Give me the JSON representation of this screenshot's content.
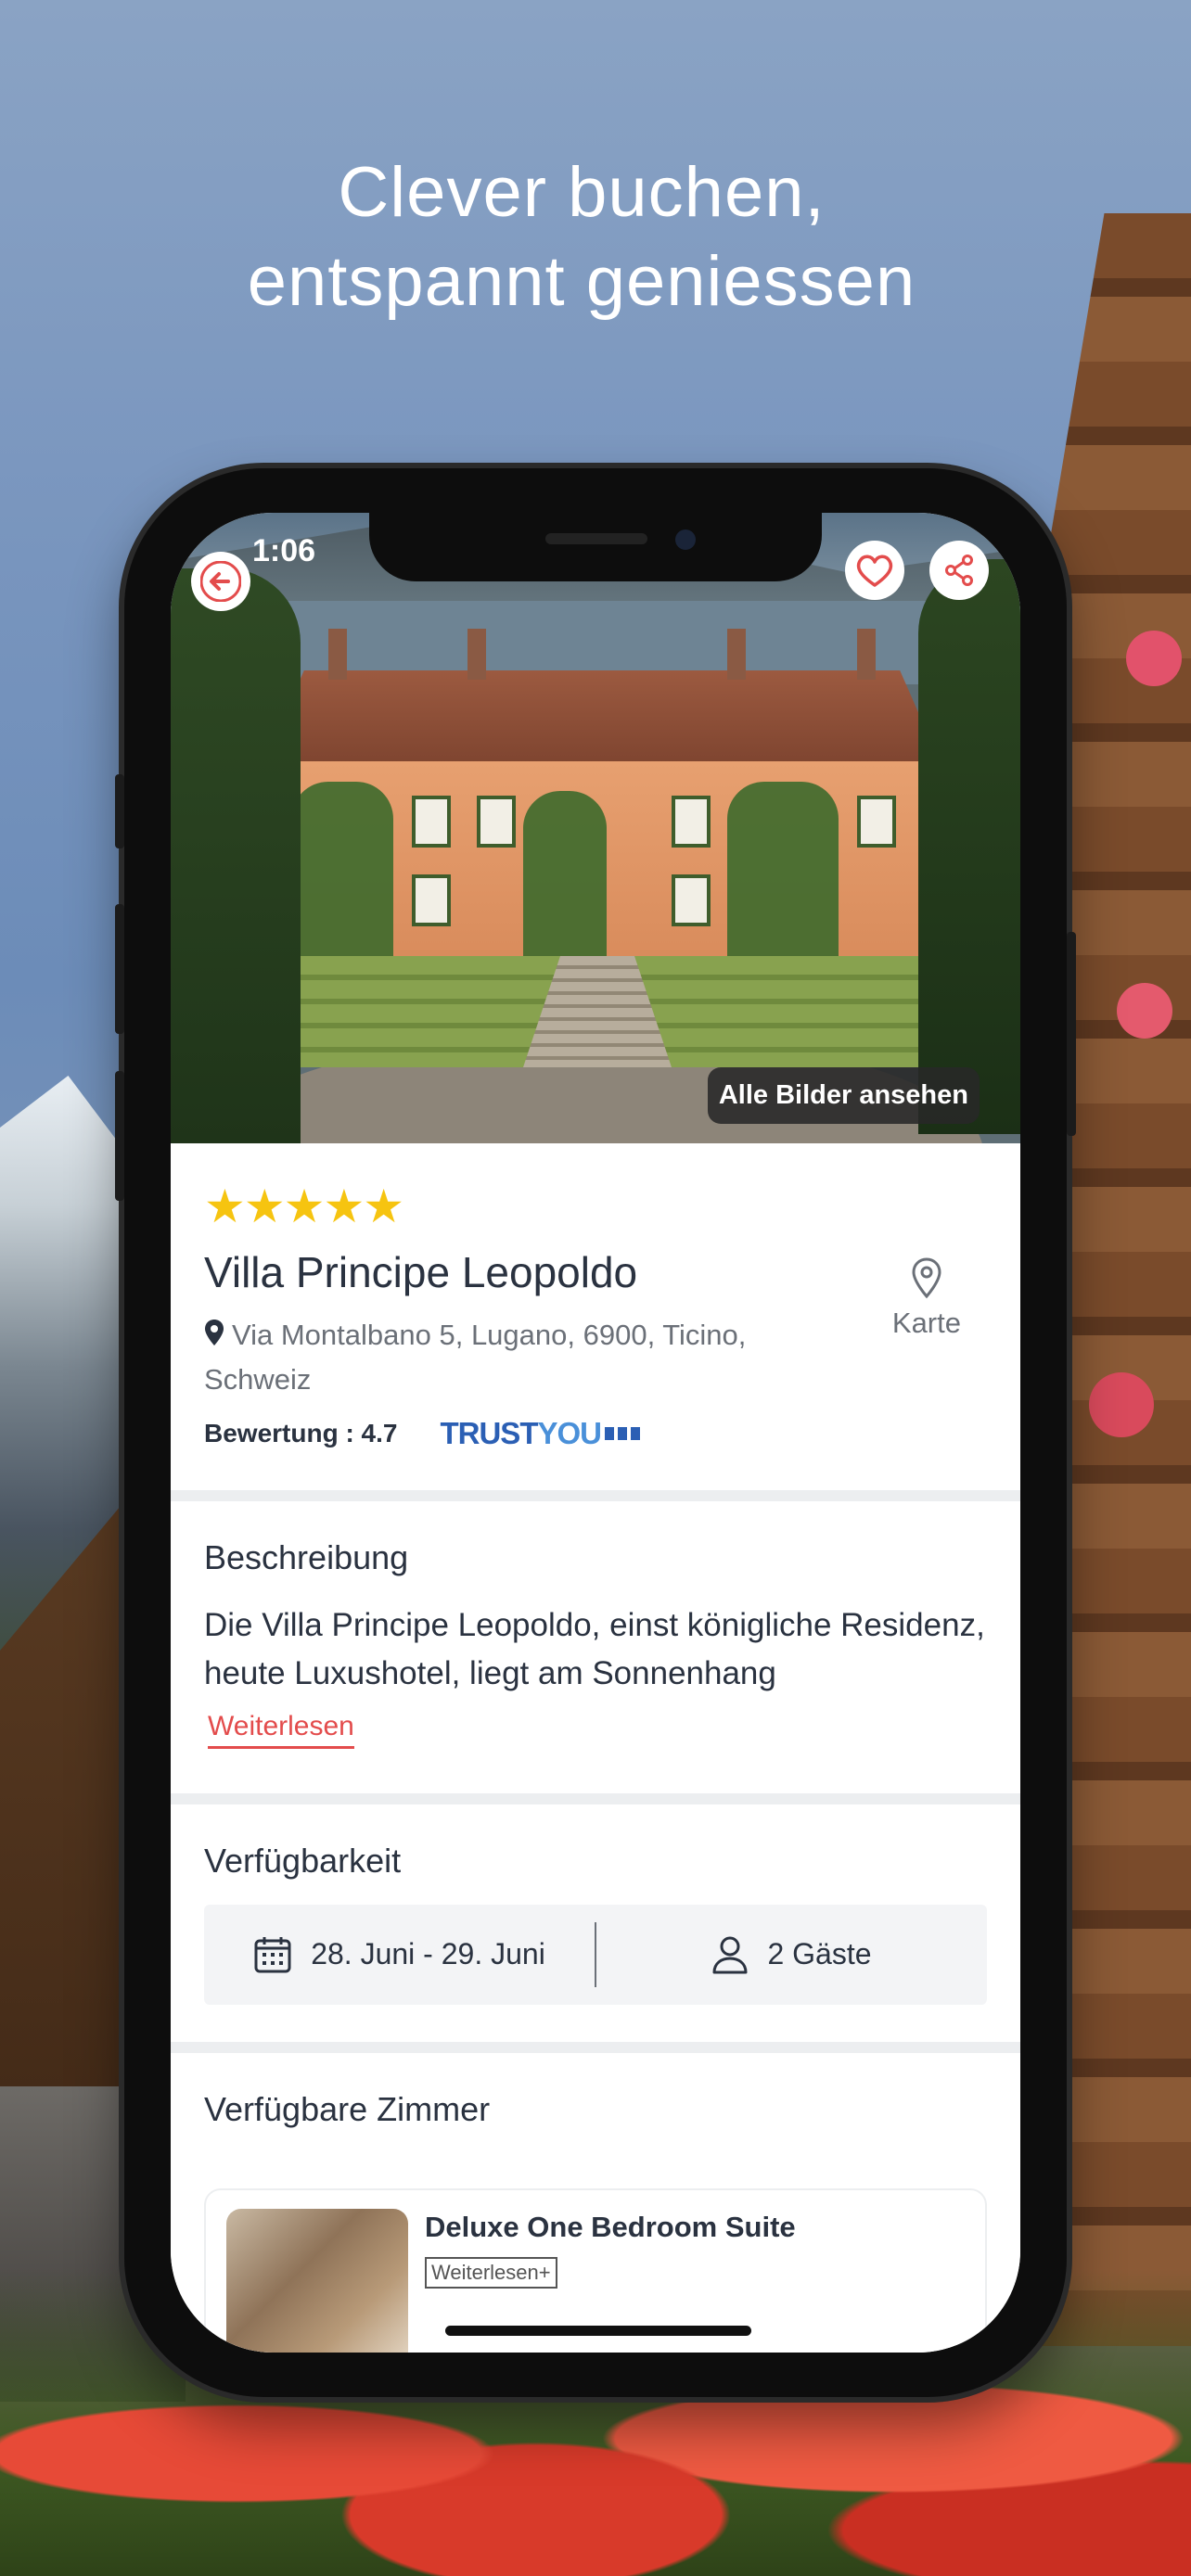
{
  "headline": {
    "line1": "Clever buchen,",
    "line2": "entspannt geniessen"
  },
  "status_bar": {
    "time": "1:06"
  },
  "hero": {
    "all_photos_label": "Alle Bilder ansehen"
  },
  "hotel": {
    "stars": "★★★★★",
    "star_count": 5,
    "name": "Villa Principe Leopoldo",
    "address": "Via Montalbano 5, Lugano, 6900, Ticino, Schweiz",
    "map_label": "Karte",
    "rating_label": "Bewertung : 4.7",
    "trustyou_part1": "TRUST",
    "trustyou_part2": "YOU"
  },
  "description": {
    "title": "Beschreibung",
    "text": "Die Villa Principe Leopoldo, einst königliche Residenz, heute Luxushotel, liegt am Sonnenhang",
    "read_more": "Weiterlesen"
  },
  "availability": {
    "title": "Verfügbarkeit",
    "dates": "28. Juni - 29. Juni",
    "guests": "2 Gäste"
  },
  "rooms": {
    "title": "Verfügbare Zimmer",
    "items": [
      {
        "name": "Deluxe One Bedroom Suite",
        "read_more": "Weiterlesen+"
      }
    ]
  },
  "colors": {
    "accent": "#e34c4c",
    "star": "#f6c410",
    "text": "#2a3240",
    "trustyou": "#2b5fb4"
  },
  "icons": [
    "back-arrow-icon",
    "heart-icon",
    "share-icon",
    "location-pin-icon",
    "calendar-icon",
    "person-icon"
  ]
}
